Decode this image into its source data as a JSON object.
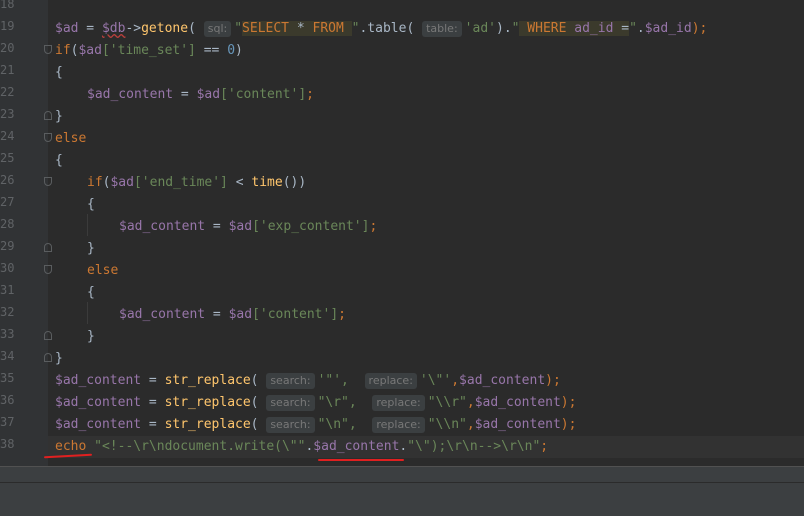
{
  "editor": {
    "line_numbers": [
      "18",
      "19",
      "20",
      "21",
      "22",
      "23",
      "24",
      "25",
      "26",
      "27",
      "28",
      "29",
      "30",
      "31",
      "32",
      "33",
      "34",
      "35",
      "36",
      "37",
      "38"
    ],
    "lines": {
      "l19": {
        "ad": "$ad",
        " eq": " = ",
        "db": "$db",
        "arrow": "->",
        "getone": "getone",
        "p1": "(",
        "hint_sql": "sql:",
        "q1": "\"",
        "sel": "SELECT",
        "star": " * ",
        "from": "FROM",
        "sp": " ",
        "q2": "\"",
        "dot1": ".",
        "table": "table",
        "p2": "(",
        "hint_table": "table:",
        "tab_str": "'ad'",
        "p3": ")",
        "dot2": ".",
        "q3": "\"",
        "where": " WHERE",
        "adid": " ad_id",
        "eq2": " =",
        "q4": "\"",
        "dot3": ".",
        "ad2": "$ad_id",
        "end": ");"
      },
      "l20": {
        "kw": "if",
        "p": "(",
        "var": "$ad",
        "key": "['time_set']",
        "rest": " == ",
        "num": "0",
        "close": ")"
      },
      "l21": {
        "brace": "{"
      },
      "l22": {
        "var": "$ad_content",
        "eq": " = ",
        "var2": "$ad",
        "key": "['content']",
        "semi": ";"
      },
      "l23": {
        "brace": "}"
      },
      "l24": {
        "kw": "else"
      },
      "l25": {
        "brace": "{"
      },
      "l26": {
        "kw": "if",
        "p": "(",
        "var": "$ad",
        "key": "['end_time']",
        "lt": " < ",
        "fn": "time",
        "end": "())"
      },
      "l27": {
        "brace": "{"
      },
      "l28": {
        "var": "$ad_content",
        "eq": " = ",
        "var2": "$ad",
        "key": "['exp_content']",
        "semi": ";"
      },
      "l29": {
        "brace": "}"
      },
      "l30": {
        "kw": "else"
      },
      "l31": {
        "brace": "{"
      },
      "l32": {
        "var": "$ad_content",
        "eq": " = ",
        "var2": "$ad",
        "key": "['content']",
        "semi": ";"
      },
      "l33": {
        "brace": "}"
      },
      "l34": {
        "brace": "}"
      },
      "l35": {
        "var": "$ad_content",
        "eq": " = ",
        "fn": "str_replace",
        "p": "(",
        "hint_search": "search:",
        "s1": "'\"',",
        "hint_replace": "replace:",
        "s2": "'\\\"'",
        "c": ",",
        "var2": "$ad_content",
        "end": ");"
      },
      "l36": {
        "var": "$ad_content",
        "eq": " = ",
        "fn": "str_replace",
        "p": "(",
        "hint_search": "search:",
        "s1": "\"\\r\",",
        "hint_replace": "replace:",
        "s2": "\"\\\\r\"",
        "c": ",",
        "var2": "$ad_content",
        "end": ");"
      },
      "l37": {
        "var": "$ad_content",
        "eq": " = ",
        "fn": "str_replace",
        "p": "(",
        "hint_search": "search:",
        "s1": "\"\\n\",",
        "hint_replace": "replace:",
        "s2": "\"\\\\n\"",
        "c": ",",
        "var2": "$ad_content",
        "end": ");"
      },
      "l38": {
        "kw": "echo",
        "s1": " \"<!--\\r\\ndocument.write(\\\"\"",
        "dot": ".",
        "var": "$ad_content",
        "dot2": ".",
        "s2": "\"\\\");\\r\\n-->\\r\\n\"",
        "semi": ";"
      }
    }
  },
  "colors": {
    "background": "#2b2b2b",
    "keyword": "#cc7832",
    "string": "#6a8759",
    "variable": "#9876aa",
    "function": "#ffc66d",
    "annotation_underline": "#e02020"
  }
}
